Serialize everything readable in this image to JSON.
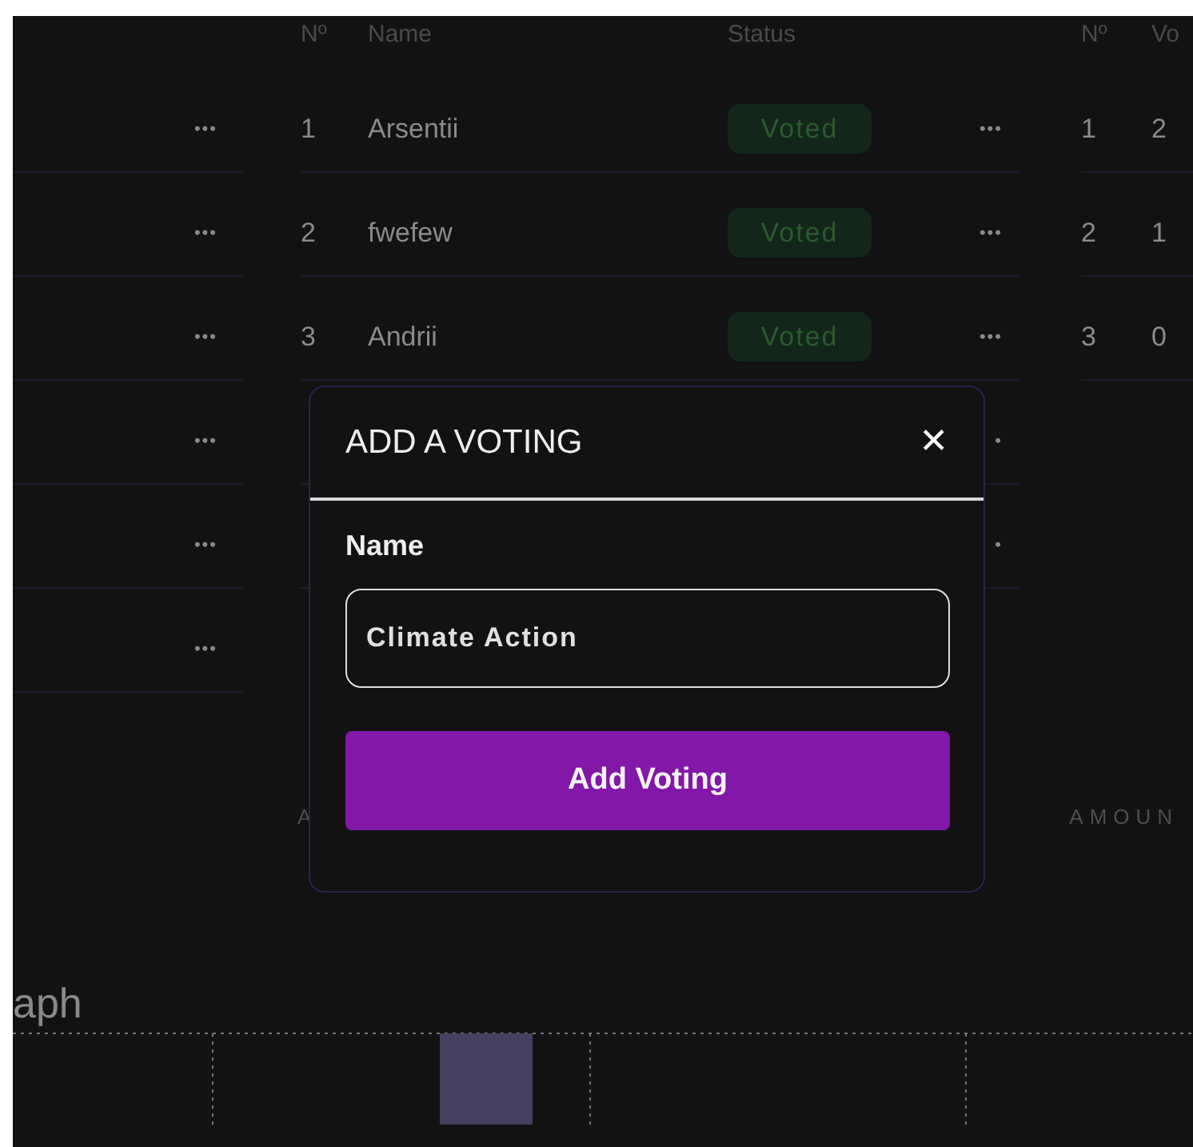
{
  "left_column": {
    "rows": [
      {
        "menu": "•••"
      },
      {
        "menu": "•••"
      },
      {
        "menu": "•••"
      },
      {
        "menu": "•••"
      },
      {
        "menu": "•••"
      },
      {
        "menu": "•••"
      }
    ]
  },
  "votes_table": {
    "columns": [
      "Nº",
      "Name",
      "Status"
    ],
    "rows": [
      {
        "number": "1",
        "name": "Arsentii",
        "status": "Voted",
        "menu": "•••"
      },
      {
        "number": "2",
        "name": "fwefew",
        "status": "Voted",
        "menu": "•••"
      },
      {
        "number": "3",
        "name": "Andrii",
        "status": "Voted",
        "menu": "•••"
      },
      {
        "menu": "•"
      },
      {
        "menu": "•"
      }
    ]
  },
  "results_table": {
    "columns": [
      "Nº",
      "Vo"
    ],
    "rows": [
      {
        "number": "1",
        "votes": "2"
      },
      {
        "number": "2",
        "votes": "1"
      },
      {
        "number": "3",
        "votes": "0"
      }
    ]
  },
  "section_labels": [
    "A",
    "AMOUN"
  ],
  "graph": {
    "title": "aph"
  },
  "modal": {
    "title": "ADD A VOTING",
    "close": "✕",
    "field_label": "Name",
    "field_value": "Climate Action",
    "submit": "Add Voting"
  }
}
